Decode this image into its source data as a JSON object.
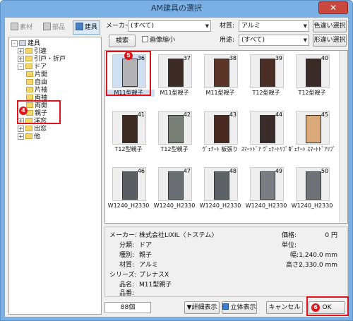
{
  "window": {
    "title": "AM建具の選択",
    "close": "✕"
  },
  "toolbar": {
    "tab_material": "素材",
    "tab_parts": "部品",
    "tab_fixtures": "建具",
    "maker_label": "メーカー:",
    "maker_value": "(すべて)",
    "material_label": "材質:",
    "material_value": "アルミ",
    "color_select": "色違い選択",
    "search": "検索",
    "shrink_label": "画像縮小",
    "usage_label": "用途:",
    "usage_value": "(すべて)",
    "shape_select": "形違い選択"
  },
  "tree": {
    "root": "建具",
    "items": [
      {
        "label": "引違",
        "exp": "+"
      },
      {
        "label": "引戸・折戸",
        "exp": "+"
      },
      {
        "label": "ドア",
        "exp": "-"
      },
      {
        "label": "片開"
      },
      {
        "label": "自由"
      },
      {
        "label": "片袖"
      },
      {
        "label": "両袖"
      },
      {
        "label": "両開"
      },
      {
        "label": "親子"
      },
      {
        "label": "洋窓",
        "exp": "+"
      },
      {
        "label": "出窓",
        "exp": "+"
      },
      {
        "label": "他",
        "exp": "+"
      }
    ]
  },
  "grid": {
    "items": [
      {
        "num": "36",
        "caption": "M11型親子",
        "color": "#b3b3b6"
      },
      {
        "num": "37",
        "caption": "M11型親子",
        "color": "#3c2c25"
      },
      {
        "num": "38",
        "caption": "M11型親子",
        "color": "#5a3528"
      },
      {
        "num": "39",
        "caption": "T12型親子",
        "color": "#4a2e26"
      },
      {
        "num": "40",
        "caption": "T12型親子",
        "color": "#3b2b28"
      },
      {
        "num": "41",
        "caption": "T12型親子",
        "color": "#3d2a22"
      },
      {
        "num": "42",
        "caption": "T12型親子",
        "color": "#7a8078"
      },
      {
        "num": "43",
        "caption": "ｳﾞｪﾅｰﾄ 板張り",
        "color": "#4a2a20"
      },
      {
        "num": "44",
        "caption": "ｽﾏｰﾄﾄﾞｱ ｳﾞｪﾅｰﾄﾘﾌﾞﾓ",
        "color": "#3a2c2a"
      },
      {
        "num": "45",
        "caption": "ｳﾞｪﾅｰﾄ ｽﾏｰﾄﾄﾞｱﾘﾌﾞ",
        "color": "#d9a97a"
      },
      {
        "num": "46",
        "caption": "W1240_H2330",
        "color": "#5a5e62"
      },
      {
        "num": "47",
        "caption": "W1240_H2330",
        "color": "#6a6e72"
      },
      {
        "num": "48",
        "caption": "W1240_H2330",
        "color": "#5e6266"
      },
      {
        "num": "49",
        "caption": "W1240_H2330",
        "color": "#7a7e82"
      },
      {
        "num": "50",
        "caption": "W1240_H2330",
        "color": "#6e7276"
      }
    ]
  },
  "info": {
    "maker_l": "メーカー:",
    "maker_v": "株式会社LIXIL〈トステム〉",
    "class_l": "分類:",
    "class_v": "ドア",
    "kind_l": "種別:",
    "kind_v": "親子",
    "mat_l": "材質:",
    "mat_v": "アルミ",
    "series_l": "シリーズ:",
    "series_v": "プレナスX",
    "name_l": "品名:",
    "name_v": "M11型親子",
    "code_l": "品番:",
    "code_v": "",
    "price_l": "価格:",
    "price_v": "0 円",
    "unit_l": "単位:",
    "unit_v": "",
    "width_l": "幅:",
    "width_v": "1,240.0 mm",
    "height_l": "高さ:",
    "height_v": "2,330.0 mm"
  },
  "footer": {
    "count": "88個",
    "detail": "▼詳細表示",
    "threed": "立体表示",
    "cancel": "キャンセル",
    "ok": "OK"
  },
  "annotations": {
    "n4": "4",
    "n5": "5",
    "n6": "6"
  }
}
